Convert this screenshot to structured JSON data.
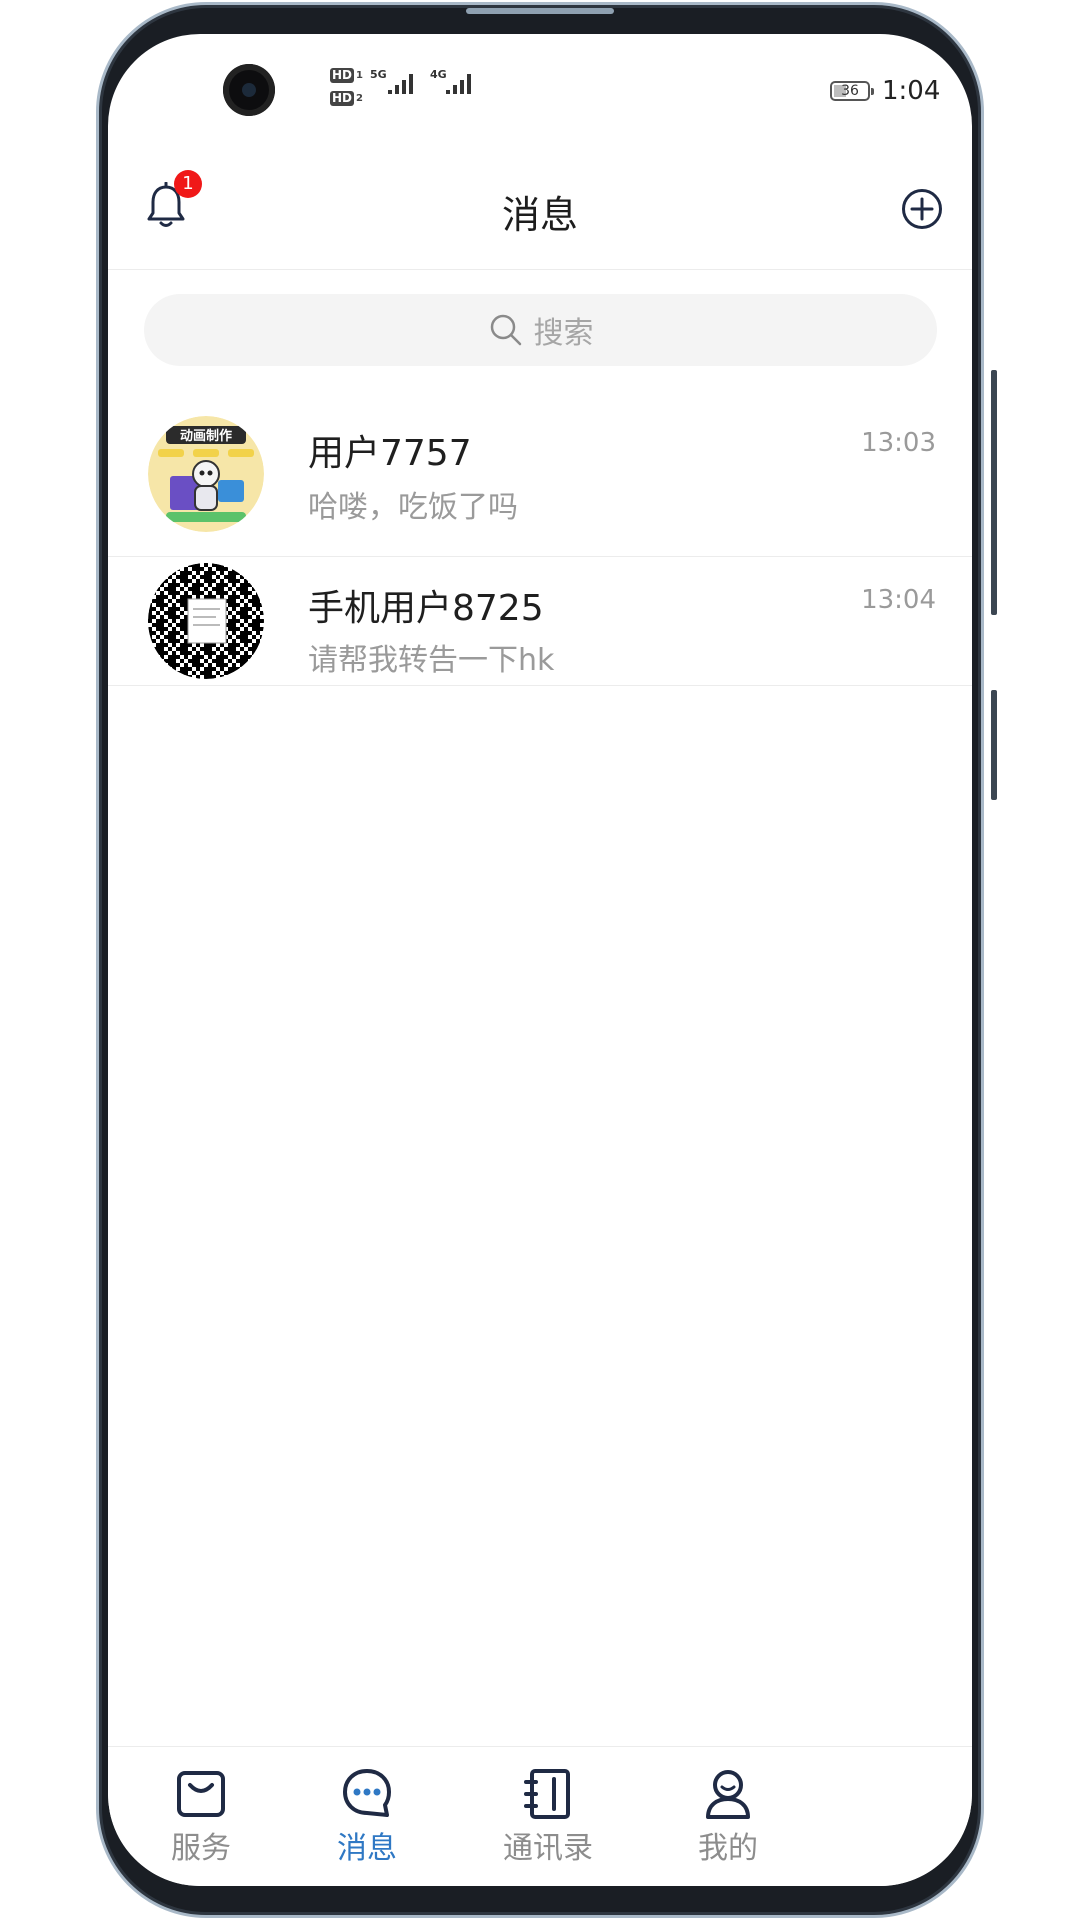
{
  "status_bar": {
    "sim1_tag": "HD",
    "sim1_index": "1",
    "sim2_tag": "HD",
    "sim2_index": "2",
    "net1": "5G",
    "net2": "4G",
    "battery_level": "36",
    "time": "1:04"
  },
  "header": {
    "title": "消息",
    "notification_count": "1",
    "notification_icon": "bell-icon",
    "add_icon": "plus-circle-icon"
  },
  "search": {
    "placeholder": "搜索",
    "icon": "search-icon"
  },
  "conversations": [
    {
      "name": "用户7757",
      "last_message": "哈喽，吃饭了吗",
      "time": "13:03",
      "avatar": "animation-avatar",
      "avatar_caption": "动画制作"
    },
    {
      "name": "手机用户8725",
      "last_message": "请帮我转告一下hk",
      "time": "13:04",
      "avatar": "qr-code-avatar"
    }
  ],
  "bottom_nav": {
    "items": [
      {
        "label": "服务",
        "icon": "shopping-bag-icon",
        "active": false
      },
      {
        "label": "消息",
        "icon": "chat-bubble-icon",
        "active": true
      },
      {
        "label": "通讯录",
        "icon": "contacts-book-icon",
        "active": false
      },
      {
        "label": "我的",
        "icon": "user-profile-icon",
        "active": false
      }
    ]
  },
  "colors": {
    "accent": "#2f78c4",
    "badge": "#f01818",
    "icon_dark": "#1f2a44"
  }
}
